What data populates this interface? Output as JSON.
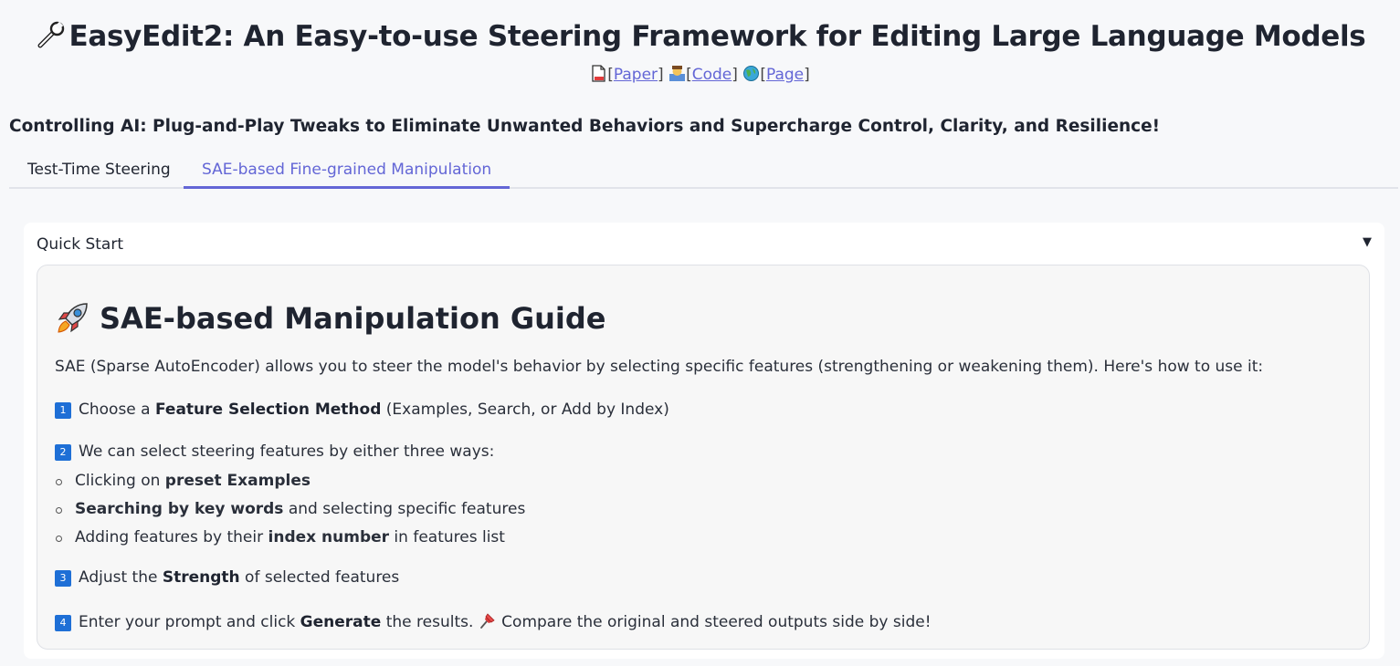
{
  "header": {
    "title": "EasyEdit2: An Easy-to-use Steering Framework for Editing Large Language Models",
    "links": [
      {
        "label": "Paper"
      },
      {
        "label": "Code"
      },
      {
        "label": "Page"
      }
    ]
  },
  "subtitle": "Controlling AI: Plug-and-Play Tweaks to Eliminate Unwanted Behaviors and Supercharge Control, Clarity, and Resilience!",
  "tabs": [
    {
      "label": "Test-Time Steering",
      "active": false
    },
    {
      "label": "SAE-based Fine-grained Manipulation",
      "active": true
    }
  ],
  "accordion": {
    "label": "Quick Start",
    "arrow": "▼"
  },
  "guide": {
    "heading": "SAE-based Manipulation Guide",
    "intro": "SAE (Sparse AutoEncoder) allows you to steer the model's behavior by selecting specific features (strengthening or weakening them). Here's how to use it:",
    "step1": {
      "num": "1",
      "pre": "Choose a ",
      "bold": "Feature Selection Method",
      "post": " (Examples, Search, or Add by Index)"
    },
    "step2": {
      "num": "2",
      "text": "We can select steering features by either three ways:"
    },
    "bullets": [
      {
        "pre": "Clicking on ",
        "bold": "preset Examples",
        "post": ""
      },
      {
        "pre": "",
        "bold": "Searching by key words",
        "post": " and selecting specific features"
      },
      {
        "pre": "Adding features by their ",
        "bold": "index number",
        "post": " in features list"
      }
    ],
    "step3": {
      "num": "3",
      "pre": "Adjust the ",
      "bold": "Strength",
      "post": " of selected features"
    },
    "step4": {
      "num": "4",
      "pre": "Enter your prompt and click ",
      "bold": "Generate",
      "post": " the results. ",
      "post2": " Compare the original and steered outputs side by side!"
    }
  },
  "icons": {
    "title": "wrench-icon",
    "paper": "page-icon",
    "code": "technologist-icon",
    "page": "globe-icon",
    "guide": "rocket-icon",
    "step4": "pushpin-icon"
  },
  "colors": {
    "accent": "#6366d6",
    "number_badge": "#1e6fd6",
    "background": "#f7f8fa"
  }
}
